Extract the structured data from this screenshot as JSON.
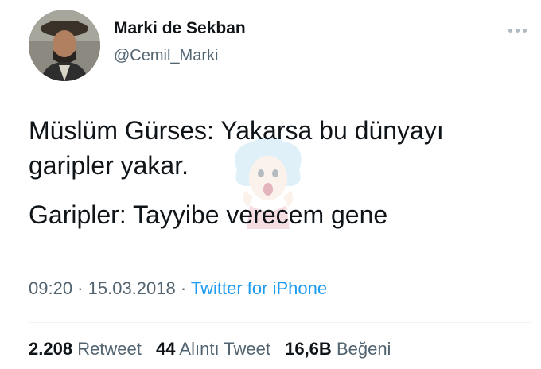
{
  "author": {
    "display_name": "Marki de Sekban",
    "handle": "@Cemil_Marki"
  },
  "tweet": {
    "line1": "Müslüm Gürses: Yakarsa bu dünyayı garipler yakar.",
    "line2": "Garipler: Tayyibe verecem gene"
  },
  "meta": {
    "time": "09:20",
    "separator1": " · ",
    "date": "15.03.2018",
    "separator2": " · ",
    "source": "Twitter for iPhone"
  },
  "stats": {
    "retweets_count": "2.208",
    "retweets_label": "Retweet",
    "quotes_count": "44",
    "quotes_label": "Alıntı Tweet",
    "likes_count": "16,6B",
    "likes_label": "Beğeni"
  },
  "colors": {
    "link": "#1d9bf0",
    "secondary_text": "#536471",
    "primary_text": "#0f1419"
  }
}
